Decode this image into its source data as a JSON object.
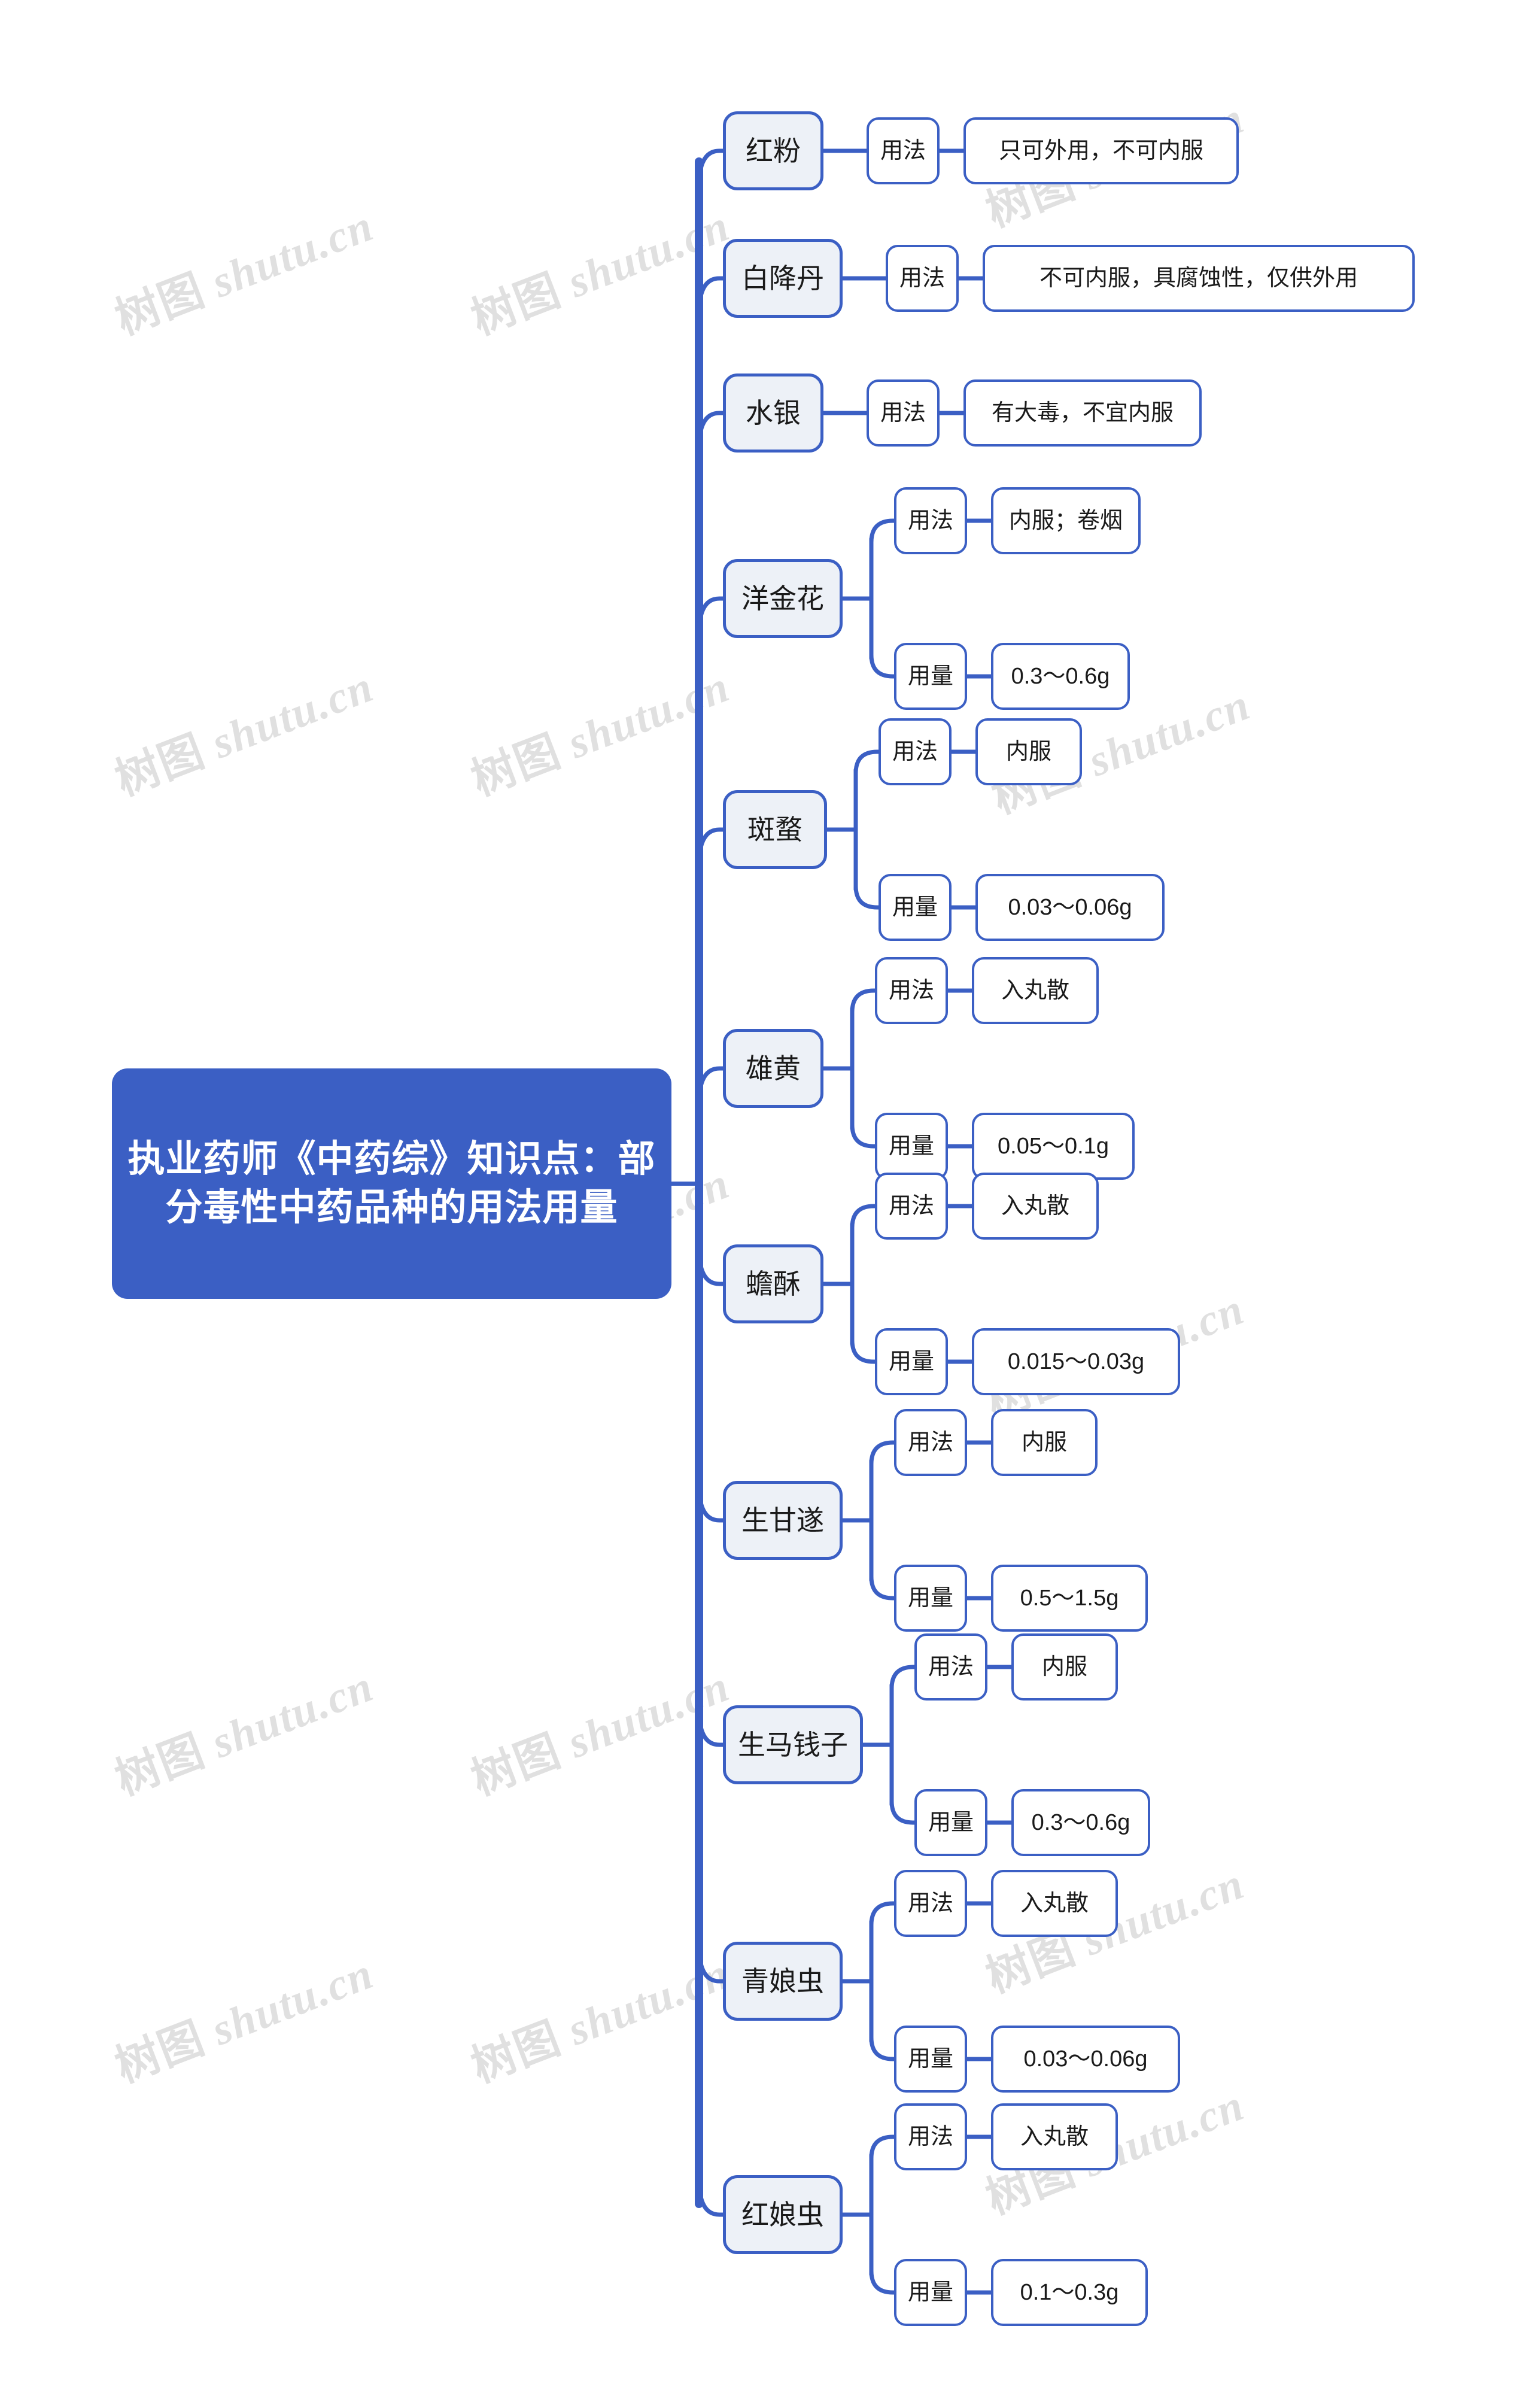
{
  "colors": {
    "accent": "#3B5FC4",
    "level1_fill": "#EDF1F7",
    "node_fill": "#FFFFFF",
    "text": "#1A1A1A",
    "root_text": "#FFFFFF",
    "watermark": "#E0E0E0",
    "canvas": "#FFFFFF"
  },
  "watermark": {
    "cjk": "树图",
    "latin": "shutu.cn",
    "full": "树图 shutu.cn"
  },
  "mindmap": {
    "root": {
      "label": "执业药师《中药综》知识点：部分毒性中药品种的用法用量"
    },
    "labels": {
      "usage": "用法",
      "dose": "用量"
    },
    "branches": [
      {
        "name": "红粉",
        "children": [
          {
            "label": "用法",
            "value": "只可外用，不可内服"
          }
        ]
      },
      {
        "name": "白降丹",
        "children": [
          {
            "label": "用法",
            "value": "不可内服，具腐蚀性，仅供外用"
          }
        ]
      },
      {
        "name": "水银",
        "children": [
          {
            "label": "用法",
            "value": "有大毒，不宜内服"
          }
        ]
      },
      {
        "name": "洋金花",
        "children": [
          {
            "label": "用法",
            "value": "内服；卷烟"
          },
          {
            "label": "用量",
            "value": "0.3～0.6g"
          }
        ]
      },
      {
        "name": "斑蝥",
        "children": [
          {
            "label": "用法",
            "value": "内服"
          },
          {
            "label": "用量",
            "value": "0.03～0.06g"
          }
        ]
      },
      {
        "name": "雄黄",
        "children": [
          {
            "label": "用法",
            "value": "入丸散"
          },
          {
            "label": "用量",
            "value": "0.05～0.1g"
          }
        ]
      },
      {
        "name": "蟾酥",
        "children": [
          {
            "label": "用法",
            "value": "入丸散"
          },
          {
            "label": "用量",
            "value": "0.015～0.03g"
          }
        ]
      },
      {
        "name": "生甘遂",
        "children": [
          {
            "label": "用法",
            "value": "内服"
          },
          {
            "label": "用量",
            "value": "0.5～1.5g"
          }
        ]
      },
      {
        "name": "生马钱子",
        "children": [
          {
            "label": "用法",
            "value": "内服"
          },
          {
            "label": "用量",
            "value": "0.3～0.6g"
          }
        ]
      },
      {
        "name": "青娘虫",
        "children": [
          {
            "label": "用法",
            "value": "入丸散"
          },
          {
            "label": "用量",
            "value": "0.03～0.06g"
          }
        ]
      },
      {
        "name": "红娘虫",
        "children": [
          {
            "label": "用法",
            "value": "入丸散"
          },
          {
            "label": "用量",
            "value": "0.1～0.3g"
          }
        ]
      }
    ]
  }
}
